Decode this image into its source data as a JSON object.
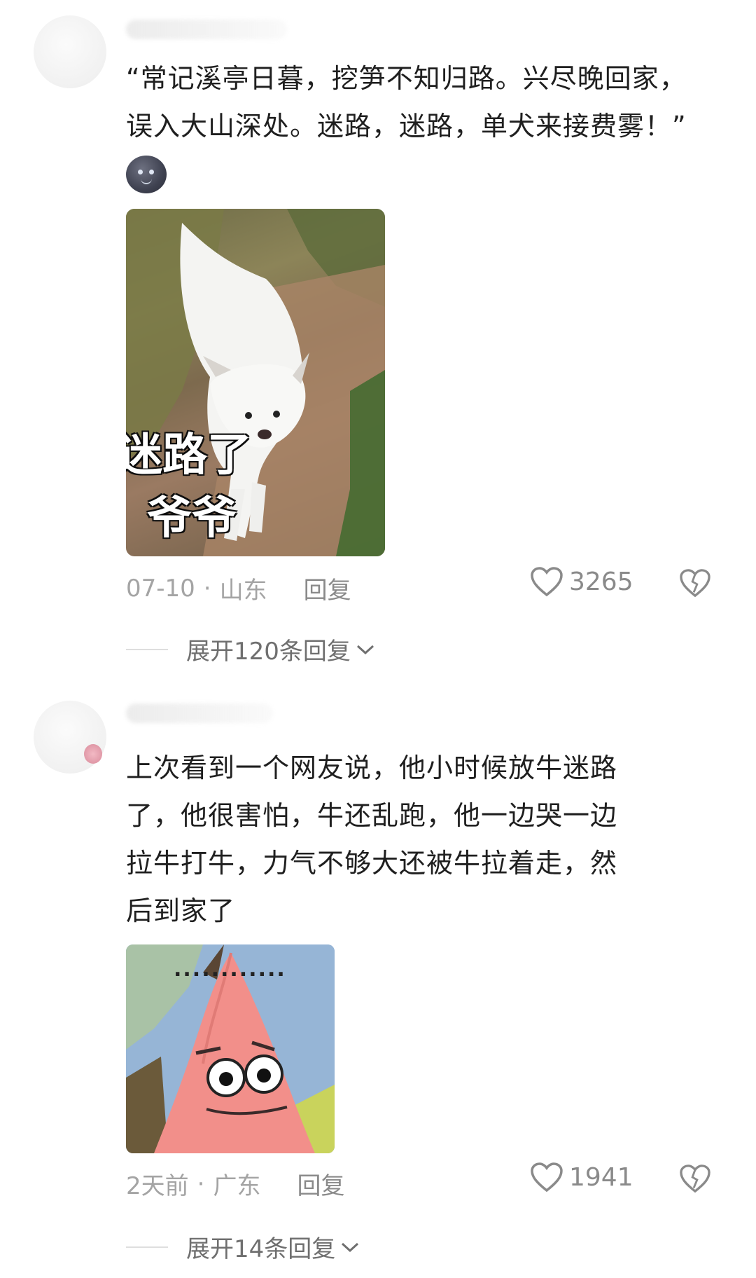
{
  "comments": [
    {
      "text_lines": [
        "“常记溪亭日暮，挖笋不知归路。兴尽晚回家，",
        "误入大山深处。迷路，迷路，单犬来接费雾！”"
      ],
      "emoji": "moon-face-emoji",
      "image": {
        "subject": "white dog on hillside path",
        "caption_lines": [
          "迷路了",
          "爷爷"
        ]
      },
      "date": "07-10",
      "separator": "·",
      "location": "山东",
      "reply_label": "回复",
      "likes": "3265",
      "expand_label": "展开120条回复"
    },
    {
      "text_lines": [
        "上次看到一个网友说，他小时候放牛迷路",
        "了，他很害怕，牛还乱跑，他一边哭一边",
        "拉牛打牛，力气不够大还被牛拉着走，然",
        "后到家了"
      ],
      "image": {
        "subject": "pink cartoon starfish",
        "dots": "............"
      },
      "date": "2天前",
      "separator": "·",
      "location": "广东",
      "reply_label": "回复",
      "likes": "1941",
      "expand_label": "展开14条回复"
    }
  ],
  "icons": {
    "like": "heart-outline-icon",
    "dislike": "broken-heart-icon",
    "expand": "chevron-down-icon"
  },
  "colors": {
    "meta_gray": "#a4a4a4",
    "text_dark": "#1f1f1f"
  }
}
